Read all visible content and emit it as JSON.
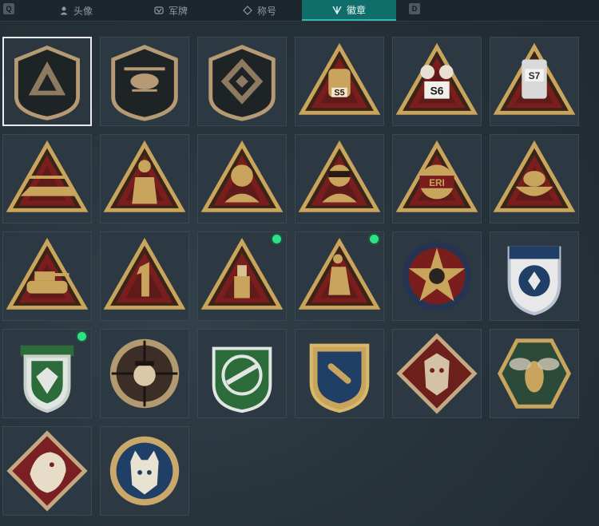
{
  "tabs": {
    "left_key": "Q",
    "right_key": "D",
    "items": [
      {
        "label": "头像",
        "icon": "person-icon",
        "active": false
      },
      {
        "label": "军牌",
        "icon": "dogtag-icon",
        "active": false
      },
      {
        "label": "称号",
        "icon": "title-icon",
        "active": false
      },
      {
        "label": "徽章",
        "icon": "emblem-icon",
        "active": true
      }
    ]
  },
  "colors": {
    "gold": "#c8a45c",
    "dark_red": "#7a1d1d",
    "green": "#2c6b3a",
    "navy": "#1f3f66",
    "new_indicator": "#2fe08a"
  },
  "emblems": [
    {
      "name": "shield-arrow-emblem",
      "text": "",
      "selected": true,
      "new": false
    },
    {
      "name": "helicopter-shield-emblem",
      "text": "",
      "selected": false,
      "new": false
    },
    {
      "name": "diamond-shield-emblem",
      "text": "",
      "selected": false,
      "new": false
    },
    {
      "name": "s5-lantern-emblem",
      "text": "S5",
      "selected": false,
      "new": false
    },
    {
      "name": "s6-emblem",
      "text": "S6",
      "selected": false,
      "new": false
    },
    {
      "name": "s7-canister-emblem",
      "text": "S7",
      "selected": false,
      "new": false
    },
    {
      "name": "aircraft-emblem",
      "text": "",
      "selected": false,
      "new": false
    },
    {
      "name": "silhouettes-emblem",
      "text": "",
      "selected": false,
      "new": false
    },
    {
      "name": "soldier-headset-emblem",
      "text": "",
      "selected": false,
      "new": false
    },
    {
      "name": "soldier-visor-emblem",
      "text": "",
      "selected": false,
      "new": false
    },
    {
      "name": "eri-globe-emblem",
      "text": "ERI",
      "selected": false,
      "new": false
    },
    {
      "name": "egg-nest-emblem",
      "text": "",
      "selected": false,
      "new": false
    },
    {
      "name": "tank-emblem",
      "text": "",
      "selected": false,
      "new": false
    },
    {
      "name": "number-one-emblem",
      "text": "1",
      "selected": false,
      "new": false
    },
    {
      "name": "usb-drive-emblem",
      "text": "",
      "selected": false,
      "new": true
    },
    {
      "name": "figure-emblem",
      "text": "",
      "selected": false,
      "new": true
    },
    {
      "name": "star-skull-emblem",
      "text": "",
      "selected": false,
      "new": false
    },
    {
      "name": "blue-shield-emblem",
      "text": "",
      "selected": false,
      "new": false
    },
    {
      "name": "green-gem-emblem",
      "text": "",
      "selected": false,
      "new": true
    },
    {
      "name": "crosshair-skull-emblem",
      "text": "",
      "selected": false,
      "new": false
    },
    {
      "name": "rifle-crosshair-emblem",
      "text": "",
      "selected": false,
      "new": false
    },
    {
      "name": "bullet-crosshair-emblem",
      "text": "",
      "selected": false,
      "new": false
    },
    {
      "name": "wolf-emblem",
      "text": "",
      "selected": false,
      "new": false
    },
    {
      "name": "hornet-emblem",
      "text": "",
      "selected": false,
      "new": false
    },
    {
      "name": "dragon-emblem",
      "text": "",
      "selected": false,
      "new": false
    },
    {
      "name": "lynx-emblem",
      "text": "",
      "selected": false,
      "new": false
    }
  ]
}
